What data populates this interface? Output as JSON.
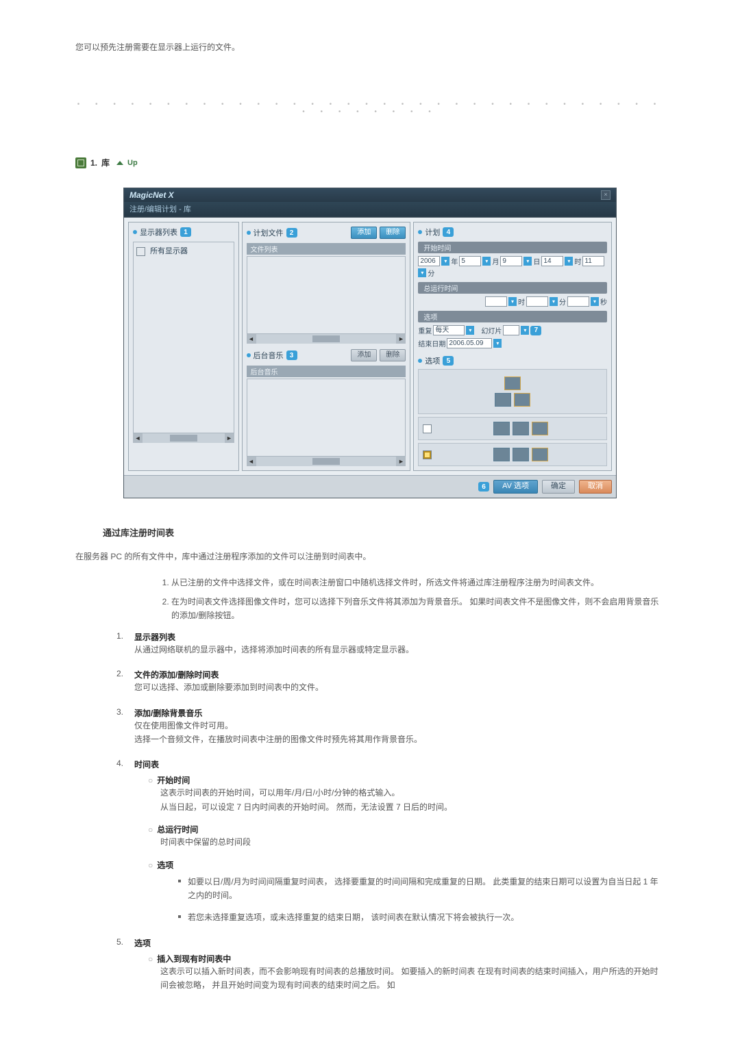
{
  "intro": "您可以预先注册需要在显示器上运行的文件。",
  "section_head": {
    "index": "1.",
    "name": "库",
    "up": "Up"
  },
  "dialog": {
    "title": "MagicNet X",
    "subtitle": "注册/编辑计划 - 库",
    "left": {
      "header": "显示器列表",
      "badge": "1",
      "tree_root": "所有显示器"
    },
    "mid": {
      "files_header": "计划文件",
      "files_badge": "2",
      "btn_add": "添加",
      "btn_del": "删除",
      "files_panel_label": "文件列表",
      "bgm_header": "后台音乐",
      "bgm_badge": "3",
      "bgm_btn_add": "添加",
      "bgm_btn_del": "删除",
      "bgm_panel_label": "后台音乐"
    },
    "right": {
      "header": "计划",
      "badge": "4",
      "start_label": "开始时间",
      "year": "2006",
      "ym": "年",
      "mon": "5",
      "mm": "月",
      "day": "9",
      "dm": "日",
      "hour": "14",
      "hm": "时",
      "min": "11",
      "minm": "分",
      "dur_label": "总运行时间",
      "dur_h": "",
      "dur_hm": "时",
      "dur_m": "",
      "dur_mm": "分",
      "dur_s": "",
      "dur_sm": "秒",
      "opt_label": "选项",
      "repeat_label": "重复",
      "repeat_val": "每天",
      "slide_label": "幻灯片",
      "opt_badge7": "7",
      "enddate_label": "结束日期",
      "enddate_val": "2006.05.09",
      "option_header": "选项",
      "option_badge": "5"
    },
    "footer": {
      "badge": "6",
      "av": "AV 选项",
      "ok": "确定",
      "cancel": "取消"
    }
  },
  "doc": {
    "h3": "通过库注册时间表",
    "p1": "在服务器 PC 的所有文件中，库中通过注册程序添加的文件可以注册到时间表中。",
    "ol1": "从已注册的文件中选择文件，或在时间表注册窗口中随机选择文件时，所选文件将通过库注册程序注册为时间表文件。",
    "ol2": "在为时间表文件选择图像文件时，您可以选择下列音乐文件将其添加为背景音乐。 如果时间表文件不是图像文件，则不会启用背景音乐的添加/删除按钮。",
    "items": {
      "i1_t": "显示器列表",
      "i1_d": "从通过网络联机的显示器中，选择将添加时间表的所有显示器或特定显示器。",
      "i2_t": "文件的添加/删除时间表",
      "i2_d": "您可以选择、添加或删除要添加到时间表中的文件。",
      "i3_t": "添加/删除背景音乐",
      "i3_d1": "仅在使用图像文件时可用。",
      "i3_d2": "选择一个音频文件，在播放时间表中注册的图像文件时预先将其用作背景音乐。",
      "i4_t": "时间表",
      "i4a_t": "开始时间",
      "i4a_d1": "这表示时间表的开始时间，可以用年/月/日/小时/分钟的格式输入。",
      "i4a_d2": "从当日起，可以设定 7 日内时间表的开始时间。 然而，无法设置 7 日后的时间。",
      "i4b_t": "总运行时间",
      "i4b_d": "时间表中保留的总时间段",
      "i4c_t": "选项",
      "i4c_b1": "如要以日/周/月为时间间隔重复时间表， 选择要重复的时间间隔和完成重复的日期。 此类重复的结束日期可以设置为自当日起 1 年之内的时间。",
      "i4c_b2": "若您未选择重复选项，或未选择重复的结束日期， 该时间表在默认情况下将会被执行一次。",
      "i5_t": "选项",
      "i5a_t": "插入到现有时间表中",
      "i5a_d": "这表示可以插入新时间表，而不会影响现有时间表的总播放时间。 如要插入的新时间表 在现有时间表的结束时间插入，用户所选的开始时间会被忽略， 并且开始时间变为现有时间表的结束时间之后。 如"
    }
  }
}
